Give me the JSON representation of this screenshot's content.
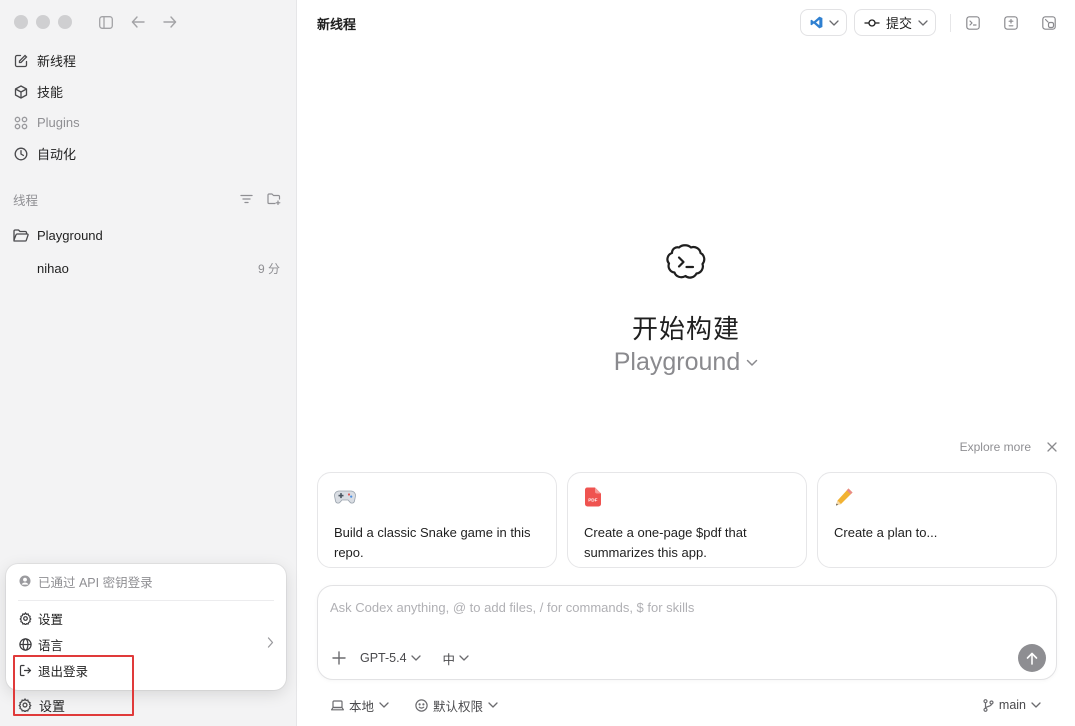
{
  "sidebar": {
    "nav": [
      {
        "label": "新线程",
        "icon": "compose-icon"
      },
      {
        "label": "技能",
        "icon": "cube-icon"
      },
      {
        "label": "Plugins",
        "icon": "plugins-icon"
      },
      {
        "label": "自动化",
        "icon": "clock-icon"
      }
    ],
    "threads_header": "线程",
    "folder": "Playground",
    "thread": {
      "title": "nihao",
      "time": "9 分"
    },
    "popup": {
      "account": "已通过 API 密钥登录",
      "settings": "设置",
      "language": "语言",
      "logout": "退出登录"
    },
    "bottom_settings": "设置"
  },
  "main": {
    "title": "新线程",
    "commit_label": "提交",
    "hero_title": "开始构建",
    "hero_project": "Playground",
    "explore_more": "Explore more",
    "cards": [
      {
        "text": "Build a classic Snake game in this repo.",
        "icon": "gamepad-icon"
      },
      {
        "text": "Create a one-page $pdf that summarizes this app.",
        "icon": "pdf-icon"
      },
      {
        "text": "Create a plan to...",
        "icon": "pencil-icon"
      }
    ],
    "composer": {
      "placeholder": "Ask Codex anything, @ to add files, / for commands, $ for skills",
      "model": "GPT-5.4",
      "effort": "中"
    },
    "footer": {
      "local": "本地",
      "permissions": "默认权限",
      "branch": "main"
    }
  },
  "colors": {
    "sidebar_bg": "#f3f3f4",
    "highlight": "#e03a3a",
    "vscode_blue": "#2f80d1",
    "pdf_red": "#ef5350"
  }
}
